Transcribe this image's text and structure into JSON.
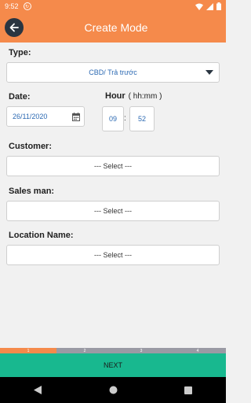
{
  "status_bar": {
    "time": "9:52"
  },
  "app_bar": {
    "title": "Create Mode"
  },
  "form": {
    "type_label": "Type:",
    "type_value": "CBD/ Trả trước",
    "date_label": "Date:",
    "date_value": "26/11/2020",
    "hour_label": "Hour",
    "hour_format": "( hh:mm )",
    "hour_value": "09",
    "minute_value": "52",
    "time_separator": ":",
    "customer_label": "Customer:",
    "customer_value": "--- Select ---",
    "salesman_label": "Sales man:",
    "salesman_value": "--- Select ---",
    "location_label": "Location Name:",
    "location_value": "--- Select ---"
  },
  "progress": {
    "steps": [
      "1",
      "2",
      "3",
      "4"
    ],
    "current": 1
  },
  "next_label": "NEXT",
  "colors": {
    "accent": "#f58a4b",
    "primary_action": "#18b88f",
    "dark": "#2a3541"
  }
}
